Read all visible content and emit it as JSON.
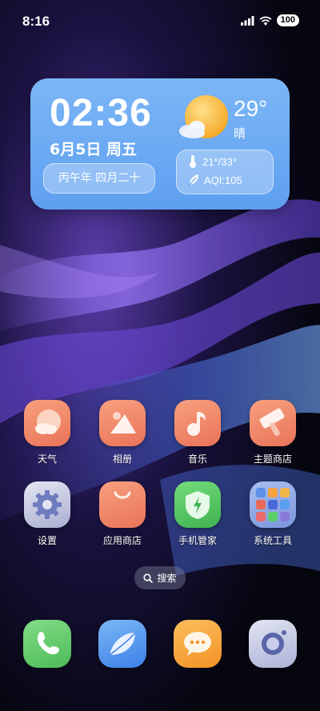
{
  "status_bar": {
    "time": "8:16",
    "battery": "100"
  },
  "widget": {
    "clock": "02:36",
    "date": "6月5日 周五",
    "lunar": "丙午年 四月二十",
    "temperature": "29°",
    "condition": "晴",
    "temp_range": "21°/33°",
    "aqi": "AQI:105",
    "weather_icon": "sun-with-cloud-icon"
  },
  "apps": [
    {
      "label": "天气",
      "icon": "weather-icon",
      "color": "#f0876a"
    },
    {
      "label": "相册",
      "icon": "gallery-icon",
      "color": "#f0876a"
    },
    {
      "label": "音乐",
      "icon": "music-icon",
      "color": "#f0876a"
    },
    {
      "label": "主题商店",
      "icon": "theme-store-icon",
      "color": "#f0876a"
    },
    {
      "label": "设置",
      "icon": "settings-icon",
      "color": "#b8bcd8"
    },
    {
      "label": "应用商店",
      "icon": "app-store-icon",
      "color": "#f0876a"
    },
    {
      "label": "手机管家",
      "icon": "phone-manager-icon",
      "color": "#5ccf6a"
    },
    {
      "label": "系统工具",
      "icon": "system-tools-folder-icon",
      "color": "#8fa8e8"
    }
  ],
  "search": {
    "label": "搜索"
  },
  "dock": [
    {
      "icon": "phone-icon",
      "color": "#6ccf72"
    },
    {
      "icon": "browser-icon",
      "color": "#5aa0f0"
    },
    {
      "icon": "messages-icon",
      "color": "#f5a23d"
    },
    {
      "icon": "camera-icon",
      "color": "#c8cde8"
    }
  ]
}
